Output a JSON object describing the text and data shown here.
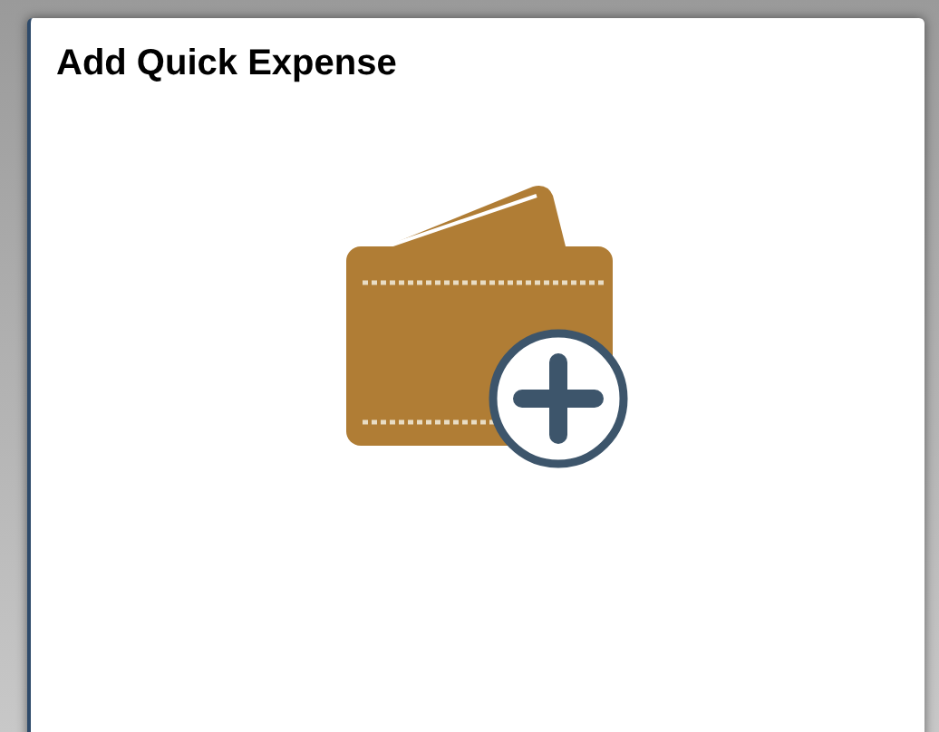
{
  "tile": {
    "title": "Add Quick Expense"
  }
}
